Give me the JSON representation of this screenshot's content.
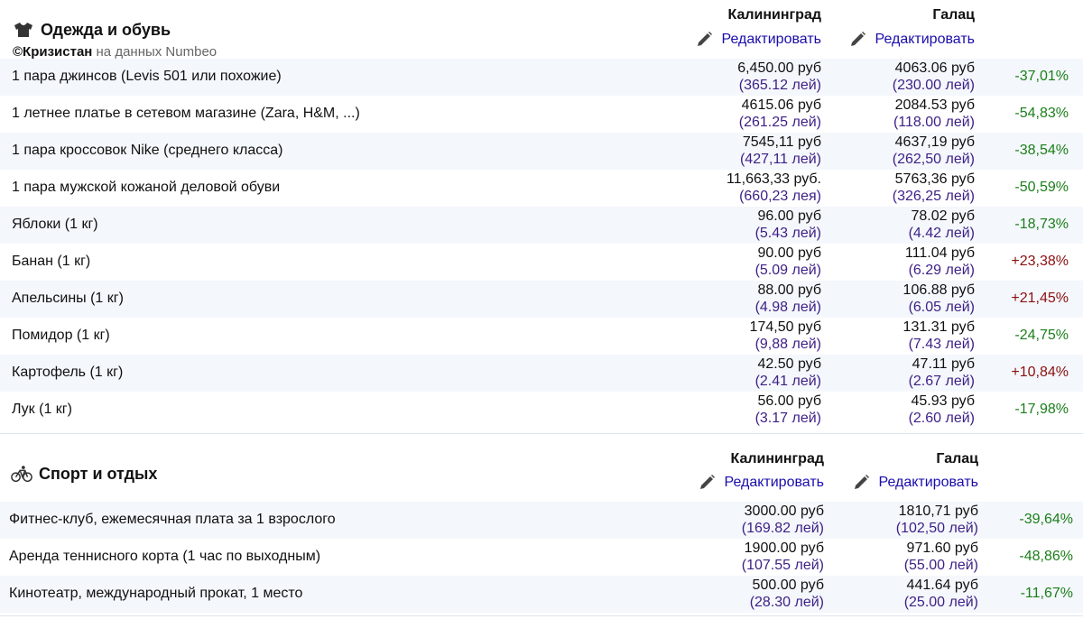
{
  "section1": {
    "title": "Одежда и обувь",
    "icon": "tshirt-icon",
    "credit_brand": "©Кризистан",
    "credit_rest": " на данных Numbeo",
    "city1": "Калининград",
    "city2": "Галац",
    "edit1": "Редактировать",
    "edit2": "Редактировать",
    "rows": [
      {
        "name": "1 пара джинсов (Levis 501 или похожие)",
        "rub1": "6,450.00 руб",
        "lei1": "(365.12 лей)",
        "rub2": "4063.06 руб",
        "lei2": "(230.00 лей)",
        "diff": "-37,01%"
      },
      {
        "name": "1 летнее платье в сетевом магазине (Zara, H&M, ...)",
        "rub1": "4615.06 руб",
        "lei1": "(261.25 лей)",
        "rub2": "2084.53 руб",
        "lei2": "(118.00 лей)",
        "diff": "-54,83%"
      },
      {
        "name": "1 пара кроссовок Nike (среднего класса)",
        "rub1": "7545,11 руб",
        "lei1": "(427,11 лей)",
        "rub2": "4637,19 руб",
        "lei2": "(262,50 лей)",
        "diff": "-38,54%"
      },
      {
        "name": "1 пара мужской кожаной деловой обуви",
        "rub1": "11,663,33 руб.",
        "lei1": "(660,23 лея)",
        "rub2": "5763,36 руб",
        "lei2": "(326,25 лей)",
        "diff": "-50,59%"
      },
      {
        "name": "Яблоки (1 кг)",
        "rub1": "96.00 руб",
        "lei1": "(5.43 лей)",
        "rub2": "78.02 руб",
        "lei2": "(4.42 лей)",
        "diff": "-18,73%"
      },
      {
        "name": "Банан (1 кг)",
        "rub1": "90.00 руб",
        "lei1": "(5.09 лей)",
        "rub2": "111.04 руб",
        "lei2": "(6.29 лей)",
        "diff": "+23,38%"
      },
      {
        "name": "Апельсины (1 кг)",
        "rub1": "88.00 руб",
        "lei1": "(4.98 лей)",
        "rub2": "106.88 руб",
        "lei2": "(6.05 лей)",
        "diff": "+21,45%"
      },
      {
        "name": "Помидор (1 кг)",
        "rub1": "174,50 руб",
        "lei1": "(9,88 лей)",
        "rub2": "131.31 руб",
        "lei2": "(7.43 лей)",
        "diff": "-24,75%"
      },
      {
        "name": "Картофель (1 кг)",
        "rub1": "42.50 руб",
        "lei1": "(2.41 лей)",
        "rub2": "47.11 руб",
        "lei2": "(2.67 лей)",
        "diff": "+10,84%"
      },
      {
        "name": "Лук (1 кг)",
        "rub1": "56.00 руб",
        "lei1": "(3.17 лей)",
        "rub2": "45.93 руб",
        "lei2": "(2.60 лей)",
        "diff": "-17,98%"
      }
    ]
  },
  "section2": {
    "title": "Спорт и отдых",
    "icon": "bicycle-icon",
    "city1": "Калининград",
    "city2": "Галац",
    "edit1": "Редактировать",
    "edit2": "Редактировать",
    "rows": [
      {
        "name": "Фитнес-клуб, ежемесячная плата за 1 взрослого",
        "rub1": "3000.00 руб",
        "lei1": "(169.82 лей)",
        "rub2": "1810,71 руб",
        "lei2": "(102,50 лей)",
        "diff": "-39,64%"
      },
      {
        "name": "Аренда теннисного корта (1 час по выходным)",
        "rub1": "1900.00 руб",
        "lei1": "(107.55 лей)",
        "rub2": "971.60 руб",
        "lei2": "(55.00 лей)",
        "diff": "-48,86%"
      },
      {
        "name": "Кинотеатр, международный прокат, 1 место",
        "rub1": "500.00 руб",
        "lei1": "(28.30 лей)",
        "rub2": "441.64 руб",
        "lei2": "(25.00 лей)",
        "diff": "-11,67%"
      }
    ]
  },
  "colors": {
    "negative": "#1a7f1a",
    "positive": "#8b1010",
    "lei": "#3d1f86",
    "link": "#1a0dab",
    "alt_row": "#f4f7fb"
  }
}
